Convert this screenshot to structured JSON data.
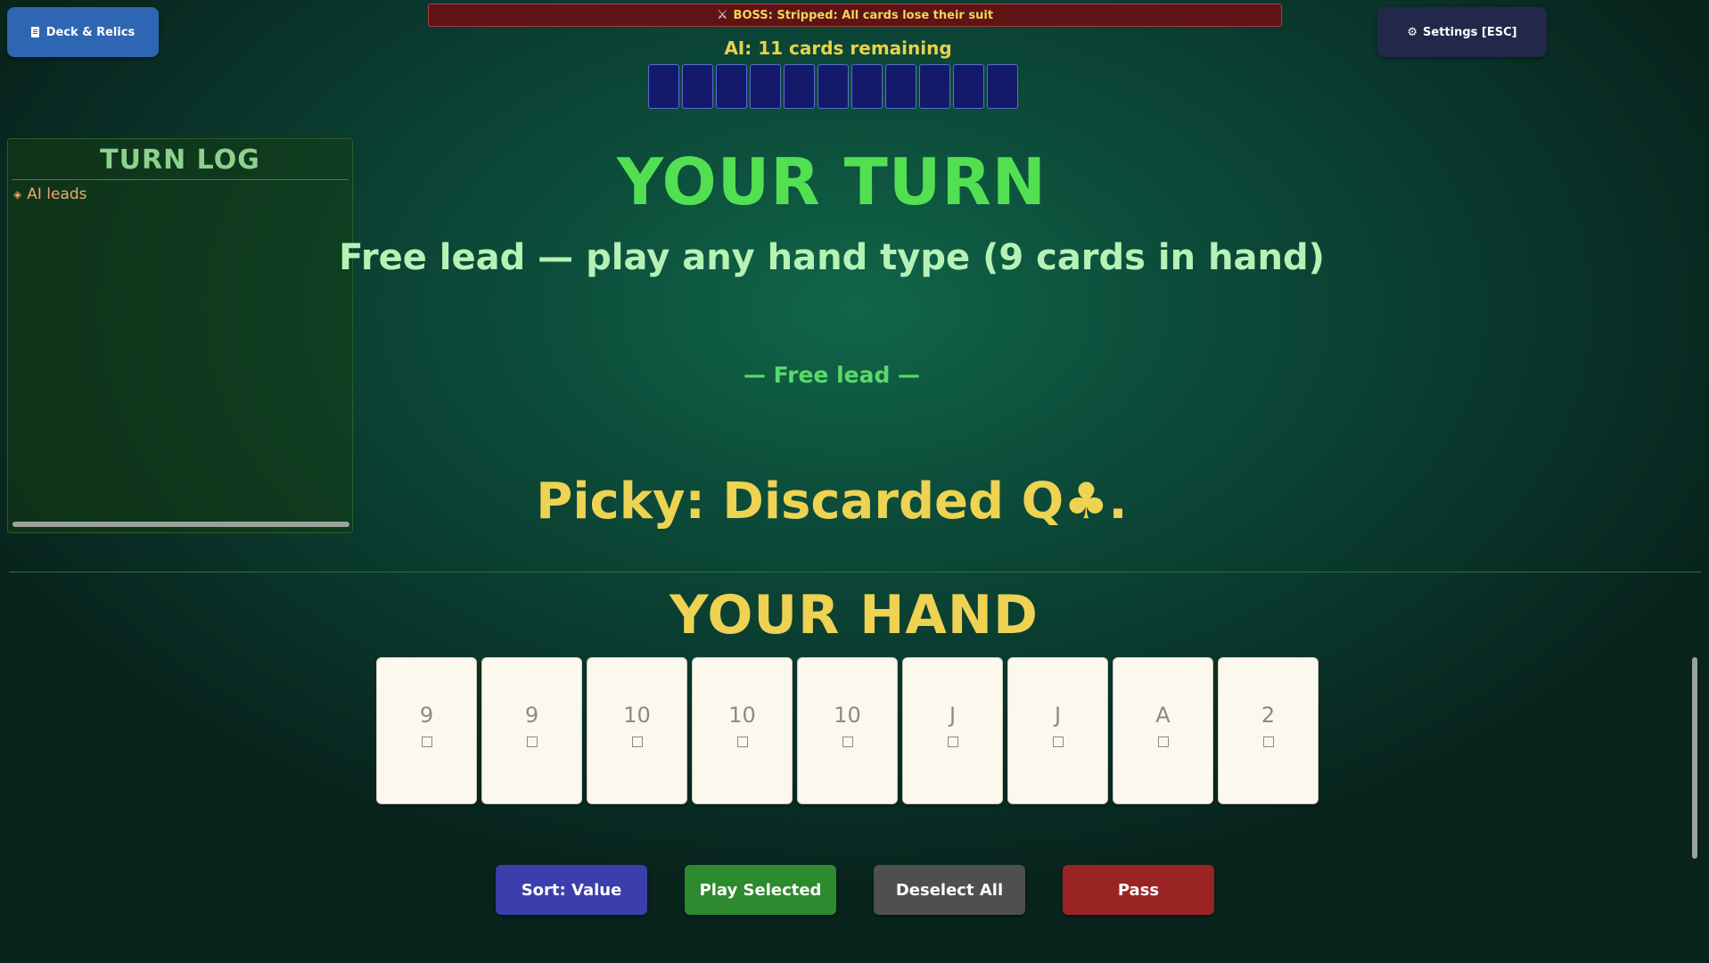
{
  "header": {
    "deck_button_label": "Deck & Relics",
    "deck_icon": "document-icon",
    "settings_button_label": "Settings [ESC]",
    "settings_icon": "gear-icon",
    "boss_icon": "crossed-swords-icon",
    "boss_text": "BOSS: Stripped: All cards lose their suit"
  },
  "ai": {
    "label": "AI:  11 cards remaining",
    "card_count": 11
  },
  "turn_log": {
    "title": "TURN LOG",
    "entries": [
      {
        "icon": "diamond-bullet-icon",
        "text": "AI leads"
      }
    ]
  },
  "status": {
    "turn_title": "YOUR TURN",
    "subtitle": "Free lead — play any hand type  (9 cards in hand)",
    "center_label": "— Free lead —",
    "message": "Picky: Discarded Q♣."
  },
  "hand": {
    "title": "YOUR HAND",
    "cards": [
      {
        "rank": "9"
      },
      {
        "rank": "9"
      },
      {
        "rank": "10"
      },
      {
        "rank": "10"
      },
      {
        "rank": "10"
      },
      {
        "rank": "J"
      },
      {
        "rank": "J"
      },
      {
        "rank": "A"
      },
      {
        "rank": "2"
      }
    ]
  },
  "actions": {
    "sort_label": "Sort: Value",
    "play_label": "Play Selected",
    "deselect_label": "Deselect All",
    "pass_label": "Pass"
  },
  "colors": {
    "sort": "#3b3eab",
    "play": "#2e8a2e",
    "deselect": "#4f4f4f",
    "pass": "#9a2424",
    "turn_title": "#52e052",
    "hand_title": "#eed252"
  }
}
